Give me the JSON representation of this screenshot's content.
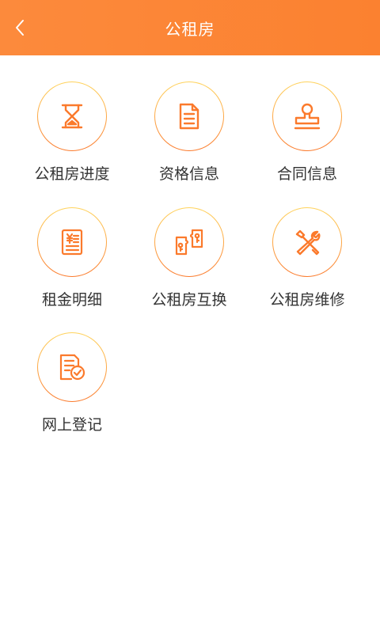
{
  "header": {
    "title": "公租房",
    "back_icon": "chevron-left-icon"
  },
  "colors": {
    "accent": "#fb8130",
    "icon_ring_top": "#ffd45c",
    "icon_ring_bottom": "#fb7a2c"
  },
  "menu": [
    {
      "label": "公租房进度",
      "icon": "hourglass-icon"
    },
    {
      "label": "资格信息",
      "icon": "document-icon"
    },
    {
      "label": "合同信息",
      "icon": "stamp-icon"
    },
    {
      "label": "租金明细",
      "icon": "yuan-bill-icon"
    },
    {
      "label": "公租房互换",
      "icon": "key-exchange-icon"
    },
    {
      "label": "公租房维修",
      "icon": "tools-icon"
    },
    {
      "label": "网上登记",
      "icon": "checked-form-icon"
    }
  ]
}
